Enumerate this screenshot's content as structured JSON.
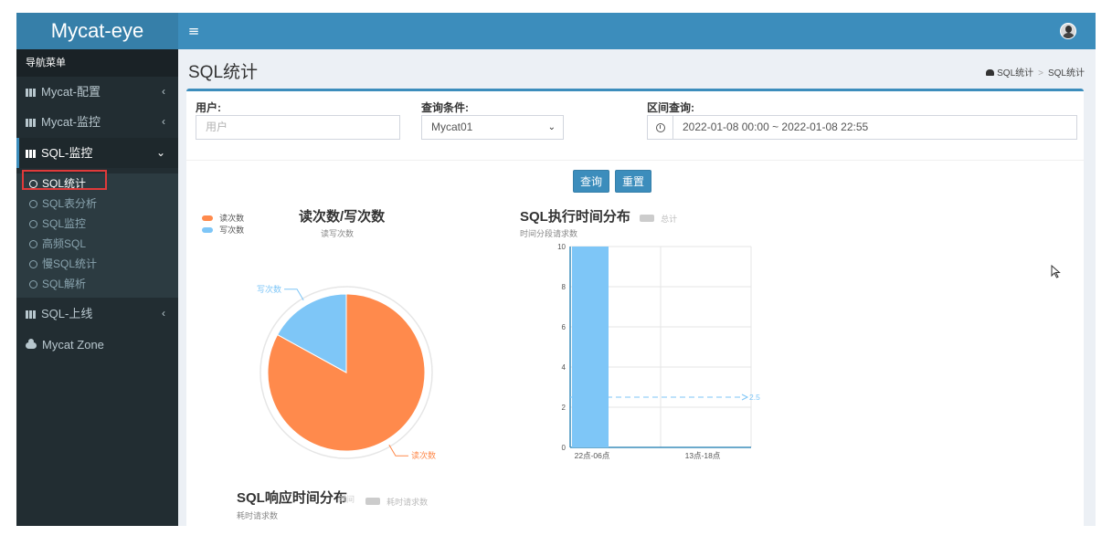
{
  "app": {
    "logo": "Mycat-eye"
  },
  "header": {
    "menu_icon": "hamburger-icon",
    "avatar_icon": "user-avatar-icon"
  },
  "sidebar": {
    "title": "导航菜单",
    "items": [
      {
        "label": "Mycat-配置",
        "chevron": "‹",
        "icon": "grid-icon"
      },
      {
        "label": "Mycat-监控",
        "chevron": "‹",
        "icon": "grid-icon"
      },
      {
        "label": "SQL-监控",
        "chevron": "⌄",
        "icon": "grid-icon",
        "open": true
      },
      {
        "label": "SQL-上线",
        "chevron": "‹",
        "icon": "grid-icon"
      },
      {
        "label": "Mycat Zone",
        "icon": "cloud-icon"
      }
    ],
    "submenu": [
      {
        "label": "SQL统计",
        "active": true
      },
      {
        "label": "SQL表分析"
      },
      {
        "label": "SQL监控"
      },
      {
        "label": "高频SQL"
      },
      {
        "label": "慢SQL统计"
      },
      {
        "label": "SQL解析"
      }
    ]
  },
  "page": {
    "title": "SQL统计",
    "breadcrumb": [
      "SQL统计",
      "SQL统计"
    ],
    "breadcrumb_icon": "dashboard-icon"
  },
  "filters": {
    "user_label": "用户:",
    "user_placeholder": "用户",
    "user_value": "",
    "condition_label": "查询条件:",
    "condition_value": "Mycat01",
    "range_label": "区间查询:",
    "range_value": "2022-01-08 00:00 ~ 2022-01-08 22:55",
    "query_button": "查询",
    "reset_button": "重置"
  },
  "colors": {
    "accent": "#3c8dbc",
    "sidebar": "#222d32",
    "read": "#ff8a4c",
    "write": "#7ec6f7"
  },
  "chart_data": [
    {
      "type": "pie",
      "title": "读次数/写次数",
      "subtitle": "读写次数",
      "legend": [
        "读次数",
        "写次数"
      ],
      "slices": [
        {
          "name": "读次数",
          "value": 83
        },
        {
          "name": "写次数",
          "value": 17
        }
      ],
      "legend_position": "top-left"
    },
    {
      "type": "bar",
      "title": "SQL执行时间分布",
      "subtitle": "时间分段请求数",
      "legend": [
        "总计"
      ],
      "categories": [
        "22点-06点",
        "13点-18点"
      ],
      "series": [
        {
          "name": "总计",
          "values": [
            10,
            0
          ]
        }
      ],
      "ylim": [
        0,
        10
      ],
      "yticks": [
        0,
        2,
        4,
        6,
        8,
        10
      ],
      "mark_line": {
        "label": "2.5",
        "value": 2.5
      },
      "grid": true
    },
    {
      "type": "bar",
      "title": "SQL响应时间分布",
      "subtitle": "耗时请求数",
      "legend": [
        "时间",
        "耗时请求数"
      ]
    }
  ]
}
